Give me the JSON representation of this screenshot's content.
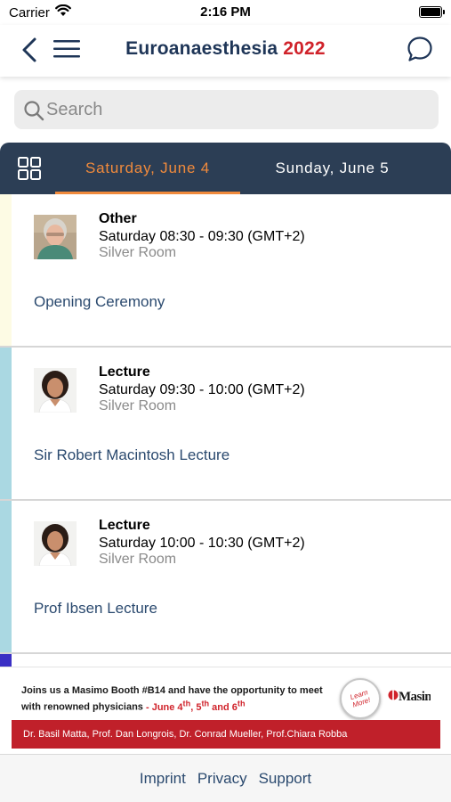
{
  "status_bar": {
    "carrier": "Carrier",
    "time": "2:16 PM"
  },
  "nav": {
    "title_main": "Euroanaesthesia",
    "title_year": "2022",
    "icons": [
      "chevron-left-icon",
      "hamburger-menu-icon",
      "chat-bubble-icon"
    ]
  },
  "search": {
    "placeholder": "Search"
  },
  "tabs": [
    {
      "label": "Saturday, June 4",
      "selected": true
    },
    {
      "label": "Sunday, June 5",
      "selected": false
    }
  ],
  "colors": {
    "accent": "#f08a3c",
    "tab_bar": "#2c3e55",
    "brand_red": "#d0232b",
    "link": "#2b4a6f"
  },
  "sessions": [
    {
      "type": "Other",
      "time": "Saturday 08:30 - 09:30 (GMT+2)",
      "room": "Silver Room",
      "title": "Opening Ceremony",
      "strip_color": "#fdfbe4"
    },
    {
      "type": "Lecture",
      "time": "Saturday 09:30 - 10:00 (GMT+2)",
      "room": "Silver Room",
      "title": "Sir Robert Macintosh Lecture",
      "strip_color": "#aad8e2"
    },
    {
      "type": "Lecture",
      "time": "Saturday 10:00 - 10:30 (GMT+2)",
      "room": "Silver Room",
      "title": "Prof Ibsen Lecture",
      "strip_color": "#aad8e2"
    }
  ],
  "ad": {
    "text": "Joins us a Masimo Booth #B14 and have the opportunity to meet with renowned physicians",
    "dates_prefix": " - June 4",
    "dates_mid1": ", 5",
    "dates_mid2": " and 6",
    "sup_th": "th",
    "learn_more": "Learn More!",
    "logo": "Masimo",
    "speakers": "Dr. Basil Matta, Prof. Dan Longrois, Dr. Conrad Mueller,  Prof.Chiara Robba"
  },
  "footer": {
    "links": [
      "Imprint",
      "Privacy",
      "Support"
    ]
  }
}
